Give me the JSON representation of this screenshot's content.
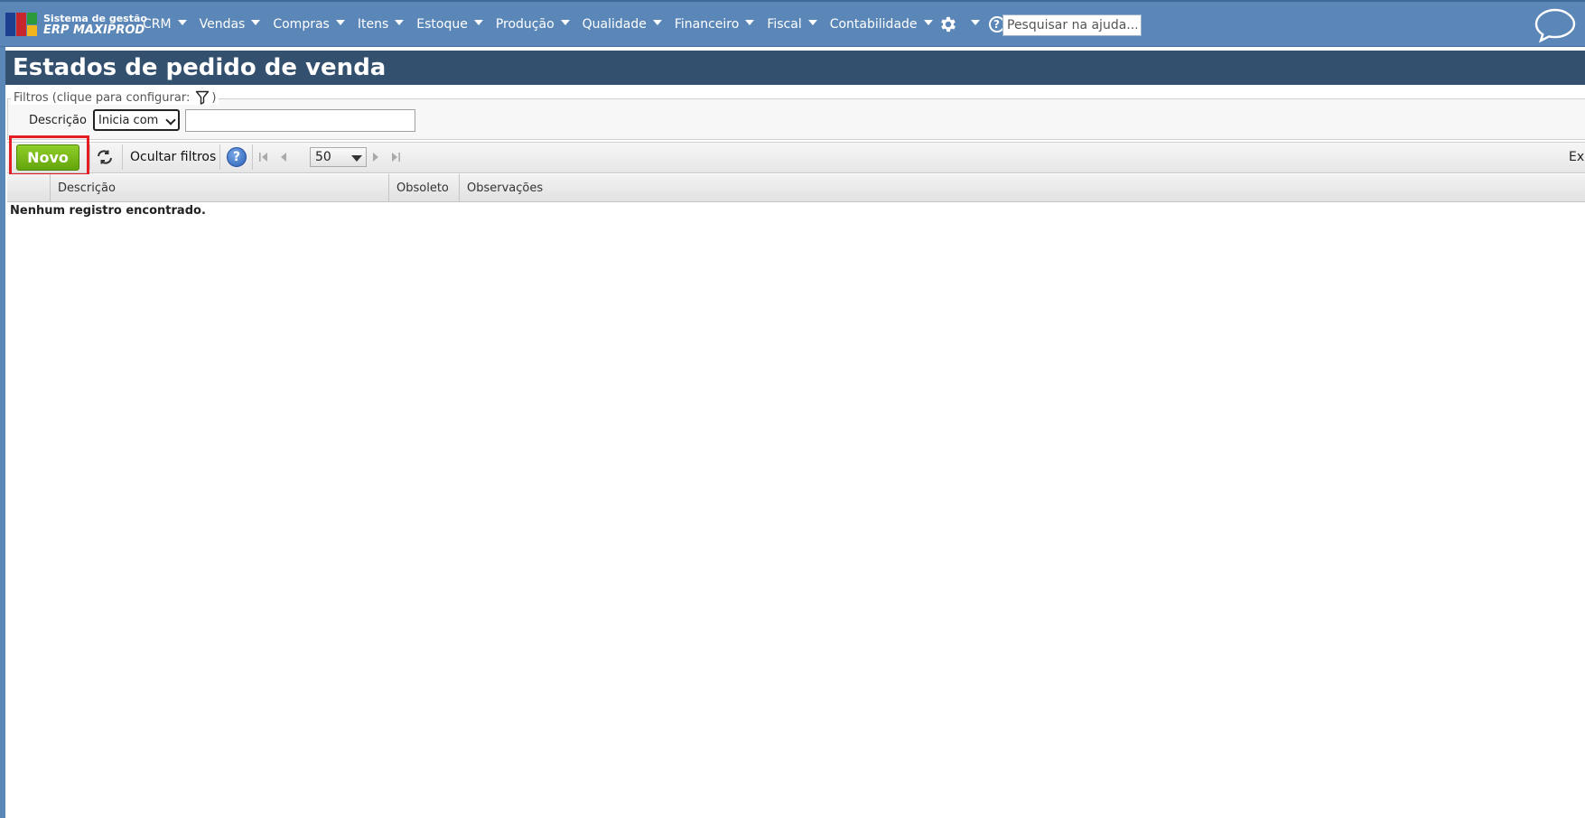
{
  "app": {
    "logo_line1": "Sistema de gestão",
    "logo_line2": "ERP MAXIPROD",
    "brand_color": "#5b87b8",
    "title_bar_color": "#34506f"
  },
  "menu": {
    "items": [
      {
        "label": "CRM"
      },
      {
        "label": "Vendas"
      },
      {
        "label": "Compras"
      },
      {
        "label": "Itens"
      },
      {
        "label": "Estoque"
      },
      {
        "label": "Produção"
      },
      {
        "label": "Qualidade"
      },
      {
        "label": "Financeiro"
      },
      {
        "label": "Fiscal"
      },
      {
        "label": "Contabilidade"
      }
    ],
    "settings_icon": "gear-icon",
    "help_icon": "question-circle-icon",
    "help_glyph": "?",
    "search_placeholder": "Pesquisar na ajuda...",
    "chat_icon": "speech-bubble-icon"
  },
  "page": {
    "title": "Estados de pedido de venda"
  },
  "filters": {
    "legend": "Filtros (clique para configurar:",
    "legend_close": ")",
    "filter_icon": "funnel-icon",
    "field_label": "Descrição",
    "operator_value": "Inicia com",
    "text_value": ""
  },
  "toolbar": {
    "new_label": "Novo",
    "new_color": "#7dbb1c",
    "highlight_color": "#e41c24",
    "refresh_icon": "refresh-icon",
    "hide_filters_label": "Ocultar filtros",
    "help_glyph": "?",
    "page_size": "50",
    "right_text": "Exi"
  },
  "grid": {
    "columns": [
      "Descrição",
      "Obsoleto",
      "Observações"
    ],
    "empty_message": "Nenhum registro encontrado."
  }
}
